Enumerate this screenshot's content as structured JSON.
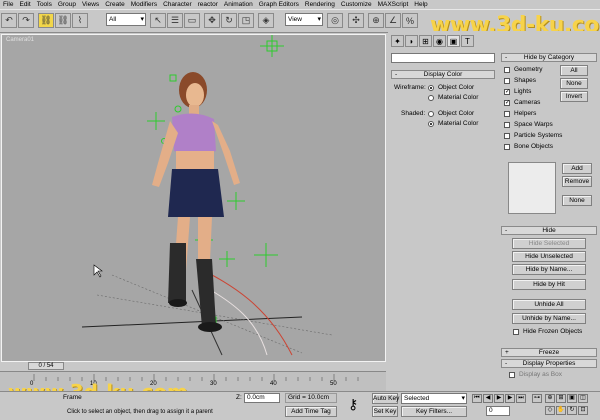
{
  "menu": [
    "File",
    "Edit",
    "Tools",
    "Group",
    "Views",
    "Create",
    "Modifiers",
    "Character",
    "reactor",
    "Animation",
    "Graph Editors",
    "Rendering",
    "Customize",
    "MAXScript",
    "Help"
  ],
  "toolbar": {
    "selection_filter": "All",
    "reference_coord": "View"
  },
  "watermark": "www.3d-ku.com",
  "viewport": {
    "label": "Camera01"
  },
  "command_panel": {
    "tabs": [
      "create",
      "modify",
      "hierarchy",
      "motion",
      "display",
      "utilities"
    ],
    "display_color": {
      "header": "Display Color",
      "wireframe_label": "Wireframe:",
      "shaded_label": "Shaded:",
      "object_color": "Object Color",
      "material_color": "Material Color"
    },
    "hide_by_category": {
      "header": "Hide by Category",
      "items": [
        {
          "label": "Geometry",
          "checked": false
        },
        {
          "label": "Shapes",
          "checked": false
        },
        {
          "label": "Lights",
          "checked": true
        },
        {
          "label": "Cameras",
          "checked": true
        },
        {
          "label": "Helpers",
          "checked": false
        },
        {
          "label": "Space Warps",
          "checked": false
        },
        {
          "label": "Particle Systems",
          "checked": false
        },
        {
          "label": "Bone Objects",
          "checked": false
        }
      ],
      "all_btn": "All",
      "none_btn": "None",
      "invert_btn": "Invert",
      "add_btn": "Add",
      "remove_btn": "Remove",
      "none2_btn": "None"
    },
    "hide": {
      "header": "Hide",
      "hide_selected": "Hide Selected",
      "hide_unselected": "Hide Unselected",
      "hide_by_name": "Hide by Name...",
      "hide_by_hit": "Hide by Hit",
      "unhide_all": "Unhide All",
      "unhide_by_name": "Unhide by Name...",
      "hide_frozen": "Hide Frozen Objects"
    },
    "freeze": {
      "header": "Freeze"
    },
    "display_properties": {
      "header": "Display Properties",
      "first_item": "Display as Box"
    }
  },
  "timeline": {
    "frame_display": "0 / 54",
    "ticks": [
      "0",
      "10",
      "20",
      "30",
      "40",
      "50"
    ]
  },
  "status": {
    "frame_label": "Frame",
    "prompt": "Click to select an object, then drag to assign it a parent",
    "z_label": "Z:",
    "z_value": "0.0cm",
    "grid": "Grid = 10.0cm",
    "add_time_tag": "Add Time Tag",
    "auto_key": "Auto Key",
    "set_key": "Set Key",
    "key_mode": "Selected",
    "key_filters": "Key Filters...",
    "current_frame": "0"
  }
}
